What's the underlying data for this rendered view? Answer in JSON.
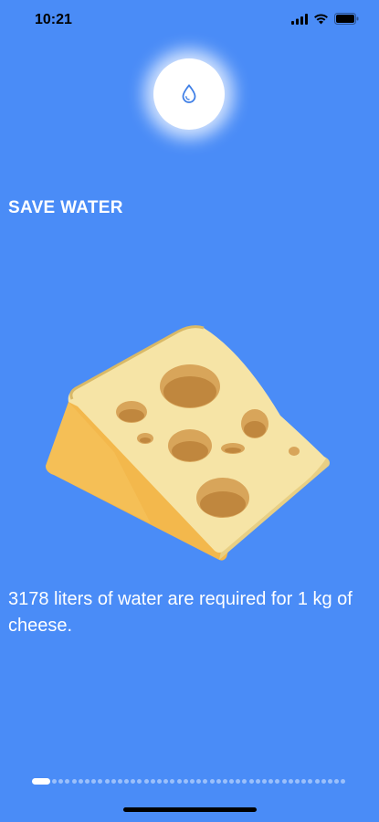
{
  "status_bar": {
    "time": "10:21",
    "icons": [
      "signal-icon",
      "wifi-icon",
      "battery-icon"
    ]
  },
  "app": {
    "logo_icon": "water-drop-icon",
    "title": "SAVE WATER",
    "illustration_icon": "cheese-icon",
    "fact_text": "3178 liters of water are required for 1 kg of cheese."
  },
  "pager": {
    "page_count": 46,
    "current_page": 1
  },
  "colors": {
    "background": "#4a8cf7",
    "text": "#ffffff"
  }
}
